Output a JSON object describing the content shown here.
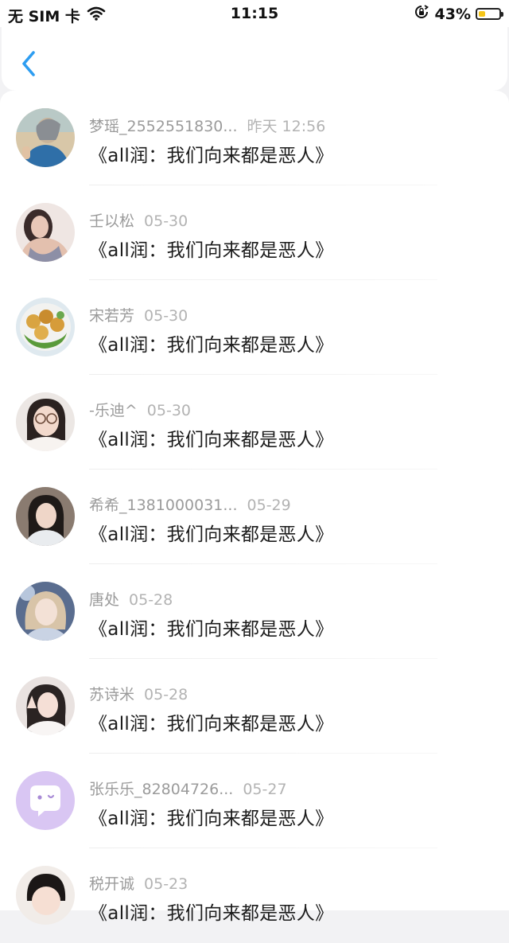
{
  "status_bar": {
    "carrier": "无 SIM 卡",
    "time": "11:15",
    "battery": "43%",
    "battery_level": 0.43
  },
  "nav": {
    "back_icon": "chevron-left-icon"
  },
  "messages": [
    {
      "name": "梦瑶_2552551830...",
      "time": "昨天 12:56",
      "text": "《all润：我们向来都是恶人》",
      "avatar": "photo-avatar-girl-blue"
    },
    {
      "name": "壬以松",
      "time": "05-30",
      "text": "《all润：我们向来都是恶人》",
      "avatar": "photo-avatar-girl-gray"
    },
    {
      "name": "宋若芳",
      "time": "05-30",
      "text": "《all润：我们向来都是恶人》",
      "avatar": "photo-avatar-food"
    },
    {
      "name": "-乐迪^",
      "time": "05-30",
      "text": "《all润：我们向来都是恶人》",
      "avatar": "photo-avatar-girl-glasses"
    },
    {
      "name": "希希_1381000031...",
      "time": "05-29",
      "text": "《all润：我们向来都是恶人》",
      "avatar": "photo-avatar-girl-dark"
    },
    {
      "name": "唐处",
      "time": "05-28",
      "text": "《all润：我们向来都是恶人》",
      "avatar": "illustration-avatar-anime"
    },
    {
      "name": "苏诗米",
      "time": "05-28",
      "text": "《all润：我们向来都是恶人》",
      "avatar": "photo-avatar-girl-peace"
    },
    {
      "name": "张乐乐_82804726...",
      "time": "05-27",
      "text": "《all润：我们向来都是恶人》",
      "avatar": "default-chat-bubble-icon"
    },
    {
      "name": "税开诚",
      "time": "05-23",
      "text": "《all润：我们向来都是恶人》",
      "avatar": "photo-avatar-child"
    }
  ],
  "colors": {
    "accent": "#2d9df1",
    "default_avatar_bg": "#d9c6f3",
    "name_gray": "#9b9b9b",
    "message_text": "#1c1c1c"
  }
}
